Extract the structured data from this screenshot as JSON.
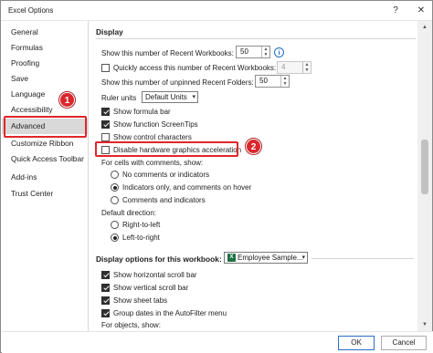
{
  "window": {
    "title": "Excel Options",
    "help_glyph": "?",
    "close_glyph": "✕"
  },
  "sidebar": {
    "items": [
      {
        "label": "General"
      },
      {
        "label": "Formulas"
      },
      {
        "label": "Proofing"
      },
      {
        "label": "Save"
      },
      {
        "label": "Language"
      },
      {
        "label": "Accessibility"
      },
      {
        "label": "Advanced"
      },
      {
        "label": "Customize Ribbon"
      },
      {
        "label": "Quick Access Toolbar"
      },
      {
        "label": "Add-ins"
      },
      {
        "label": "Trust Center"
      }
    ],
    "active": "Advanced"
  },
  "callouts": {
    "one": "1",
    "two": "2",
    "color": "#e0262b"
  },
  "display": {
    "heading": "Display",
    "recent_workbooks_label": "Show this number of Recent Workbooks:",
    "recent_workbooks_value": "50",
    "quick_access_label": "Quickly access this number of Recent Workbooks:",
    "quick_access_value": "4",
    "unpinned_folders_label": "Show this number of unpinned Recent Folders:",
    "unpinned_folders_value": "50",
    "ruler_units_label": "Ruler units",
    "ruler_units_value": "Default Units",
    "formula_bar": "Show formula bar",
    "function_screentips": "Show function ScreenTips",
    "control_characters": "Show control characters",
    "hw_accel": "Disable hardware graphics acceleration",
    "comments_heading": "For cells with comments, show:",
    "comments_opts": [
      "No comments or indicators",
      "Indicators only, and comments on hover",
      "Comments and indicators"
    ],
    "direction_heading": "Default direction:",
    "direction_opts": [
      "Right-to-left",
      "Left-to-right"
    ]
  },
  "workbook": {
    "heading": "Display options for this workbook:",
    "selector": "Employee Sample...",
    "h_scroll": "Show horizontal scroll bar",
    "v_scroll": "Show vertical scroll bar",
    "sheet_tabs": "Show sheet tabs",
    "group_dates": "Group dates in the AutoFilter menu",
    "objects_heading": "For objects, show:"
  },
  "footer": {
    "ok": "OK",
    "cancel": "Cancel"
  }
}
